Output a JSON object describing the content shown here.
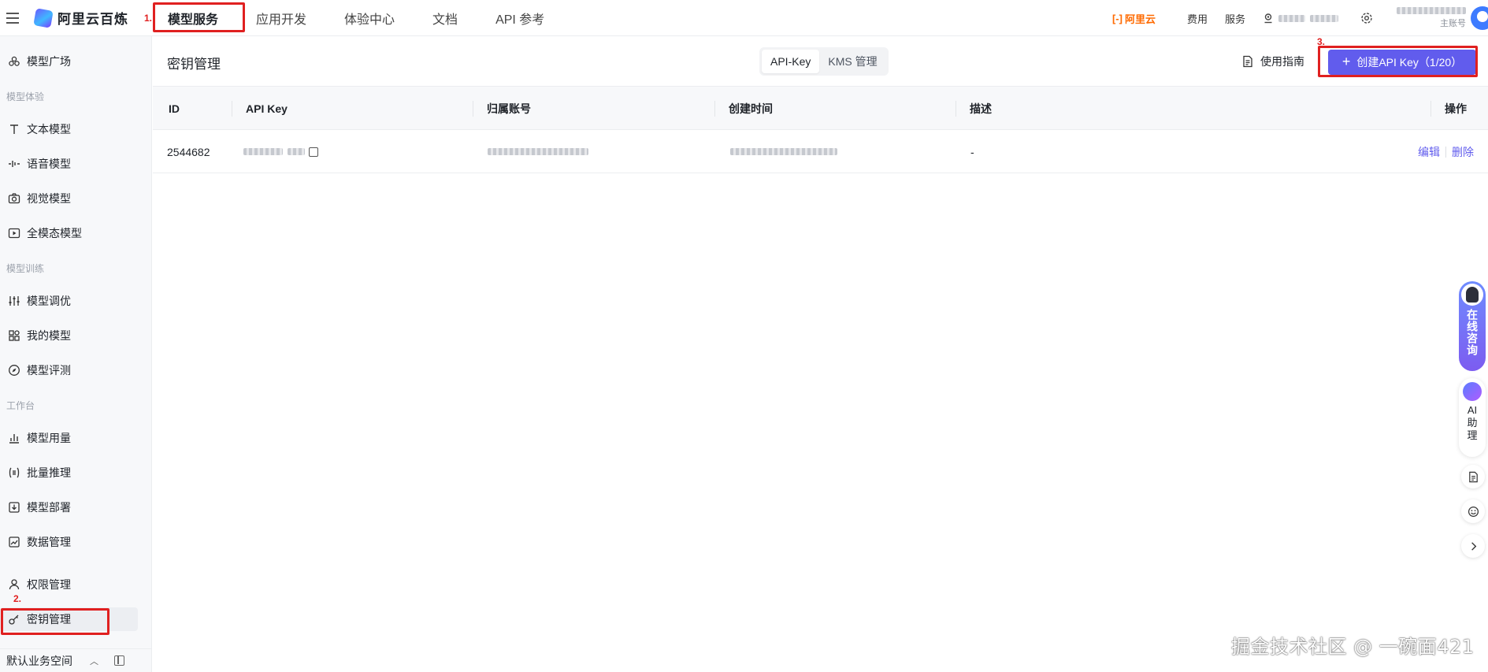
{
  "app": {
    "logo_text": "阿里云百炼"
  },
  "topnav": {
    "items": [
      {
        "label": "模型服务"
      },
      {
        "label": "应用开发"
      },
      {
        "label": "体验中心"
      },
      {
        "label": "文档"
      },
      {
        "label": "API 参考"
      }
    ],
    "right": {
      "aliyun": "阿里云",
      "fees": "费用",
      "service": "服务",
      "account_role": "主账号"
    }
  },
  "sidebar": {
    "items": [
      {
        "label": "模型广场",
        "icon": "model-square-icon"
      },
      {
        "group": "模型体验"
      },
      {
        "label": "文本模型",
        "icon": "text-icon"
      },
      {
        "label": "语音模型",
        "icon": "audio-icon"
      },
      {
        "label": "视觉模型",
        "icon": "camera-icon"
      },
      {
        "label": "全模态模型",
        "icon": "video-icon"
      },
      {
        "group": "模型训练"
      },
      {
        "label": "模型调优",
        "icon": "sliders-icon"
      },
      {
        "label": "我的模型",
        "icon": "grid-icon"
      },
      {
        "label": "模型评测",
        "icon": "compass-icon"
      },
      {
        "group": "工作台"
      },
      {
        "label": "模型用量",
        "icon": "bar-chart-icon"
      },
      {
        "label": "批量推理",
        "icon": "batch-icon"
      },
      {
        "label": "模型部署",
        "icon": "deploy-icon"
      },
      {
        "label": "数据管理",
        "icon": "data-icon"
      },
      {
        "label": "权限管理",
        "icon": "user-icon"
      },
      {
        "label": "密钥管理",
        "icon": "key-icon"
      }
    ],
    "workspace": "默认业务空间"
  },
  "page": {
    "title": "密钥管理",
    "tabs": [
      {
        "label": "API-Key",
        "active": true
      },
      {
        "label": "KMS 管理",
        "active": false
      }
    ],
    "guide_label": "使用指南",
    "create_label": "创建API Key（1/20）"
  },
  "table": {
    "columns": [
      "ID",
      "API Key",
      "归属账号",
      "创建时间",
      "描述",
      "操作"
    ],
    "rows": [
      {
        "id": "2544682",
        "api_key": "sk-****",
        "owner": "",
        "created": "",
        "desc": "-",
        "edit": "编辑",
        "delete": "删除"
      }
    ]
  },
  "annotations": [
    {
      "label": "1."
    },
    {
      "label": "2."
    },
    {
      "label": "3."
    }
  ],
  "floats": {
    "consult": "在线咨询",
    "ai": "AI助理"
  },
  "watermark": "掘金技术社区 @ 一碗面421",
  "colors": {
    "accent": "#615ced",
    "annotation": "#e02020",
    "aliyun": "#ff6a00"
  }
}
